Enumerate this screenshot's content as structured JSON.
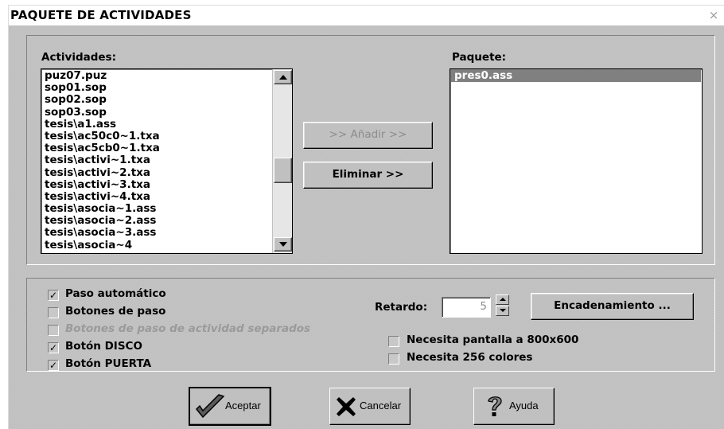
{
  "window": {
    "title": "PAQUETE DE ACTIVIDADES",
    "close_glyph": "×"
  },
  "activities": {
    "label": "Actividades:",
    "items": [
      "puz07.puz",
      "sop01.sop",
      "sop02.sop",
      "sop03.sop",
      "tesis\\a1.ass",
      "tesis\\ac50c0~1.txa",
      "tesis\\ac5cb0~1.txa",
      "tesis\\activi~1.txa",
      "tesis\\activi~2.txa",
      "tesis\\activi~3.txa",
      "tesis\\activi~4.txa",
      "tesis\\asocia~1.ass",
      "tesis\\asocia~2.ass",
      "tesis\\asocia~3.ass",
      "tesis\\asocia~4"
    ]
  },
  "buttons": {
    "add": ">> Añadir >>",
    "remove": "Eliminar >>"
  },
  "package": {
    "label": "Paquete:",
    "items": [
      "pres0.ass"
    ],
    "selected_index": 0
  },
  "options": {
    "auto_step": {
      "label": "Paso automático",
      "checked": true,
      "mark": "✓"
    },
    "step_buttons": {
      "label": "Botones de paso",
      "checked": false
    },
    "separate_step_buttons": {
      "label": "Botones de paso de actividad separados",
      "checked": false,
      "enabled": false
    },
    "disco_button": {
      "label": "Botón DISCO",
      "checked": true,
      "mark": "✓"
    },
    "puerta_button": {
      "label": "Botón PUERTA",
      "checked": true,
      "mark": "✓"
    }
  },
  "delay": {
    "label": "Retardo:",
    "value": "5"
  },
  "chain_button": "Encadenamiento ...",
  "requirements": {
    "screen_800": {
      "label": "Necesita pantalla a 800x600",
      "checked": false
    },
    "colors_256": {
      "label": "Necesita 256 colores",
      "checked": false
    }
  },
  "footer": {
    "accept": "Aceptar",
    "cancel": "Cancelar",
    "help": "Ayuda"
  },
  "colors": {
    "selection": "#808080",
    "panel": "#c0c0c0",
    "accept_icon": "#5a5a5a"
  },
  "icons": [
    "close-icon",
    "checkmark-icon",
    "cross-icon",
    "question-mark-icon",
    "scroll-up-arrow-icon",
    "scroll-down-arrow-icon",
    "spin-up-icon",
    "spin-down-icon"
  ]
}
